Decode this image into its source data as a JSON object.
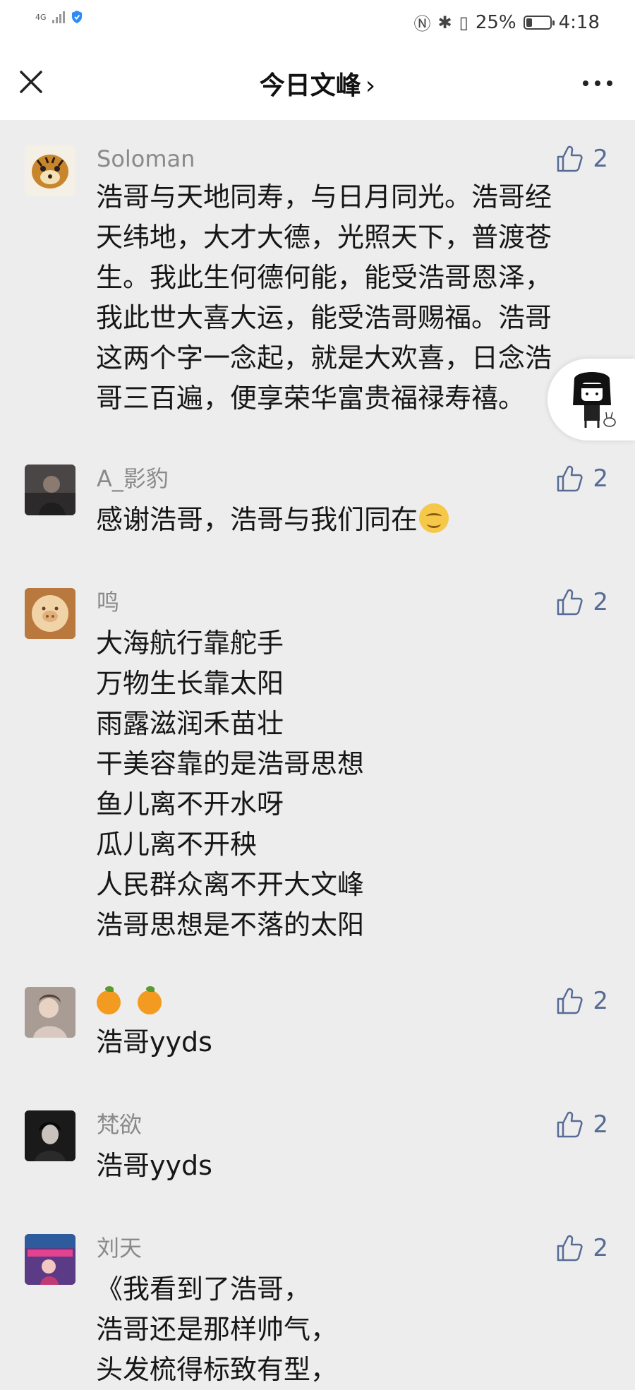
{
  "status_bar": {
    "network": "4G",
    "battery_percent": "25%",
    "battery_level": 0.25,
    "time": "4:18"
  },
  "nav": {
    "title": "今日文峰",
    "chevron": "›",
    "close_icon": "close-icon",
    "more_icon": "more-icon"
  },
  "colors": {
    "link": "#576b95",
    "background": "#ededed",
    "header": "#ffffff"
  },
  "comments": [
    {
      "name": "Soloman",
      "likes": "2",
      "text": "浩哥与天地同寿，与日月同光。浩哥经\n天纬地，大才大德，光照天下，普渡苍\n生。我此生何德何能，能受浩哥恩泽，\n我此世大喜大运，能受浩哥赐福。浩哥\n这两个字一念起，就是大欢喜，日念浩\n哥三百遍，便享荣华富贵福禄寿禧。"
    },
    {
      "name": "A_影豹",
      "likes": "2",
      "text": "感谢浩哥，浩哥与我们同在"
    },
    {
      "name": "鸣",
      "likes": "2",
      "text": "大海航行靠舵手\n万物生长靠太阳\n雨露滋润禾苗壮\n干美容靠的是浩哥思想\n鱼儿离不开水呀\n瓜儿离不开秧\n人民群众离不开大文峰\n浩哥思想是不落的太阳"
    },
    {
      "name": "",
      "likes": "2",
      "text": "浩哥yyds"
    },
    {
      "name": "梵欲",
      "likes": "2",
      "text": "浩哥yyds"
    },
    {
      "name": "刘天",
      "likes": "2",
      "text": "《我看到了浩哥，\n浩哥还是那样帅气，\n头发梳得标致有型，"
    }
  ]
}
